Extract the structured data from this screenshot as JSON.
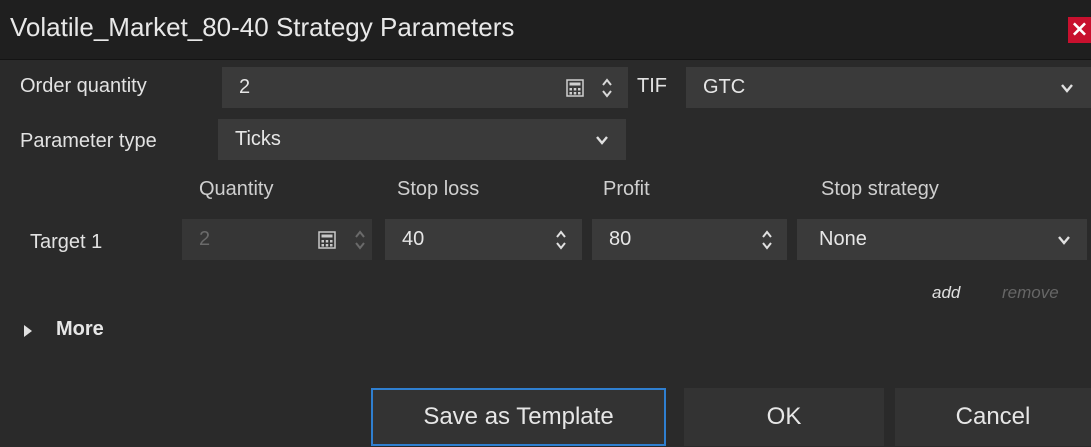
{
  "window": {
    "title": "Volatile_Market_80-40 Strategy Parameters",
    "close_glyph": "×"
  },
  "order": {
    "quantity_label": "Order quantity",
    "quantity_value": "2",
    "tif_label": "TIF",
    "tif_value": "GTC"
  },
  "parameter": {
    "label": "Parameter type",
    "value": "Ticks"
  },
  "targets": {
    "headers": {
      "quantity": "Quantity",
      "stop_loss": "Stop loss",
      "profit": "Profit",
      "stop_strategy": "Stop strategy"
    },
    "rows": [
      {
        "label": "Target 1",
        "quantity": "2",
        "stop_loss": "40",
        "profit": "80",
        "stop_strategy": "None"
      }
    ],
    "add_label": "add",
    "remove_label": "remove"
  },
  "more": {
    "label": "More"
  },
  "buttons": {
    "save_template": "Save as Template",
    "ok": "OK",
    "cancel": "Cancel"
  },
  "colors": {
    "background": "#2a2a2a",
    "titlebar": "#1f1f1f",
    "field": "#3a3a3a",
    "close": "#c8102e",
    "focus_border": "#2f7fd0"
  },
  "icons": {
    "close": "close-icon",
    "dropdown": "chevron-down-icon",
    "spinner": "spinner-arrows-icon",
    "calculator": "calculator-icon",
    "expand": "caret-right-icon"
  }
}
